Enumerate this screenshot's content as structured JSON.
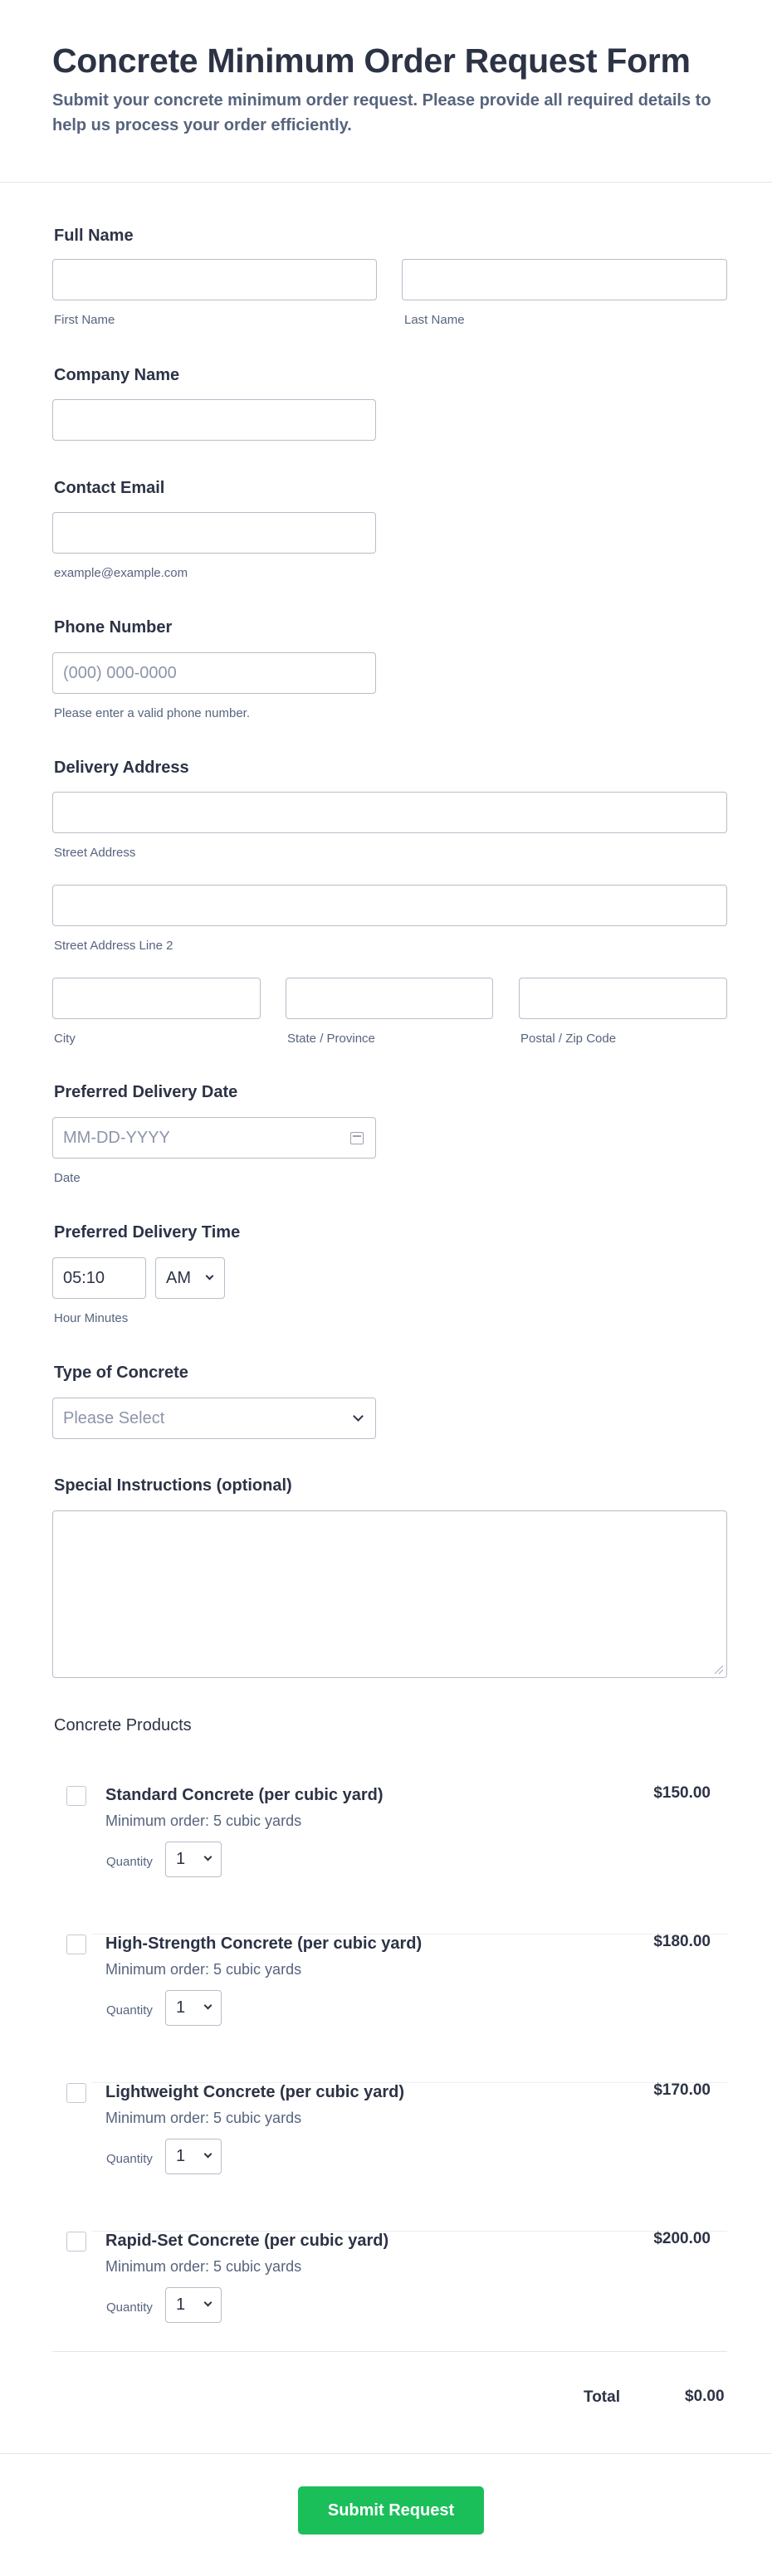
{
  "header": {
    "title": "Concrete Minimum Order Request Form",
    "subtitle": "Submit your concrete minimum order request. Please provide all required details to help us process your order efficiently."
  },
  "full_name": {
    "label": "Full Name",
    "first_sublabel": "First Name",
    "last_sublabel": "Last Name",
    "first_value": "",
    "last_value": ""
  },
  "company": {
    "label": "Company Name",
    "value": ""
  },
  "email": {
    "label": "Contact Email",
    "value": "",
    "sublabel": "example@example.com"
  },
  "phone": {
    "label": "Phone Number",
    "value": "",
    "placeholder": "(000) 000-0000",
    "sublabel": "Please enter a valid phone number."
  },
  "address": {
    "label": "Delivery Address",
    "street_sublabel": "Street Address",
    "street2_sublabel": "Street Address Line 2",
    "city_sublabel": "City",
    "state_sublabel": "State / Province",
    "zip_sublabel": "Postal / Zip Code"
  },
  "date": {
    "label": "Preferred Delivery Date",
    "placeholder": "MM-DD-YYYY",
    "sublabel": "Date",
    "icon": "calendar-icon"
  },
  "time": {
    "label": "Preferred Delivery Time",
    "value": "05:10",
    "ampm": "AM",
    "sublabel": "Hour Minutes"
  },
  "concrete_type": {
    "label": "Type of Concrete",
    "placeholder": "Please Select"
  },
  "instructions": {
    "label": "Special Instructions (optional)",
    "value": ""
  },
  "products": {
    "label": "Concrete Products",
    "quantity_label": "Quantity",
    "items": [
      {
        "name": "Standard Concrete (per cubic yard)",
        "min": "Minimum order: 5 cubic yards",
        "price": "$150.00",
        "qty": "1",
        "checked": false
      },
      {
        "name": "High-Strength Concrete (per cubic yard)",
        "min": "Minimum order: 5 cubic yards",
        "price": "$180.00",
        "qty": "1",
        "checked": false
      },
      {
        "name": "Lightweight Concrete (per cubic yard)",
        "min": "Minimum order: 5 cubic yards",
        "price": "$170.00",
        "qty": "1",
        "checked": false
      },
      {
        "name": "Rapid-Set Concrete (per cubic yard)",
        "min": "Minimum order: 5 cubic yards",
        "price": "$200.00",
        "qty": "1",
        "checked": false
      }
    ],
    "total_label": "Total",
    "total_value": "$0.00"
  },
  "submit": {
    "label": "Submit Request",
    "color": "#1bbf5a"
  }
}
